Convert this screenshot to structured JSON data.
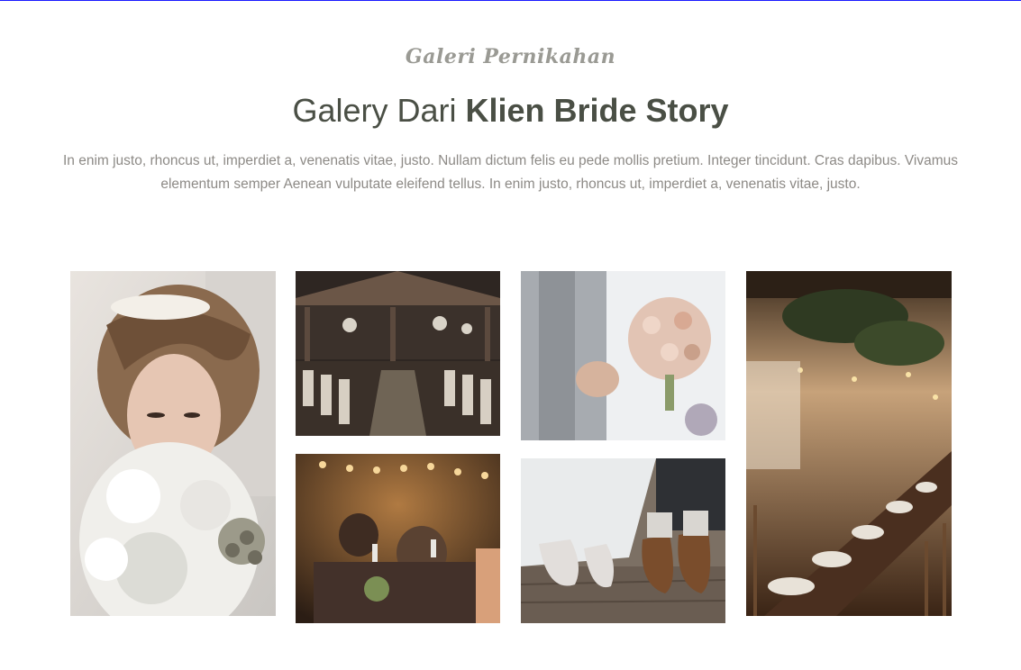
{
  "section": {
    "subtitle": "Galeri Pernikahan",
    "title_light": "Galery Dari ",
    "title_bold": "Klien Bride Story",
    "description": "In enim justo, rhoncus ut, imperdiet a, venenatis vitae, justo. Nullam dictum felis eu pede mollis pretium. Integer tincidunt. Cras dapibus. Vivamus elementum semper Aenean vulputate eleifend tellus. In enim justo, rhoncus ut, imperdiet a, venenatis vitae, justo."
  },
  "colors": {
    "title": "#4a4f45",
    "subtitle": "#9a9a94",
    "body_text": "#8d8a86",
    "top_rule": "#1a1aff"
  }
}
